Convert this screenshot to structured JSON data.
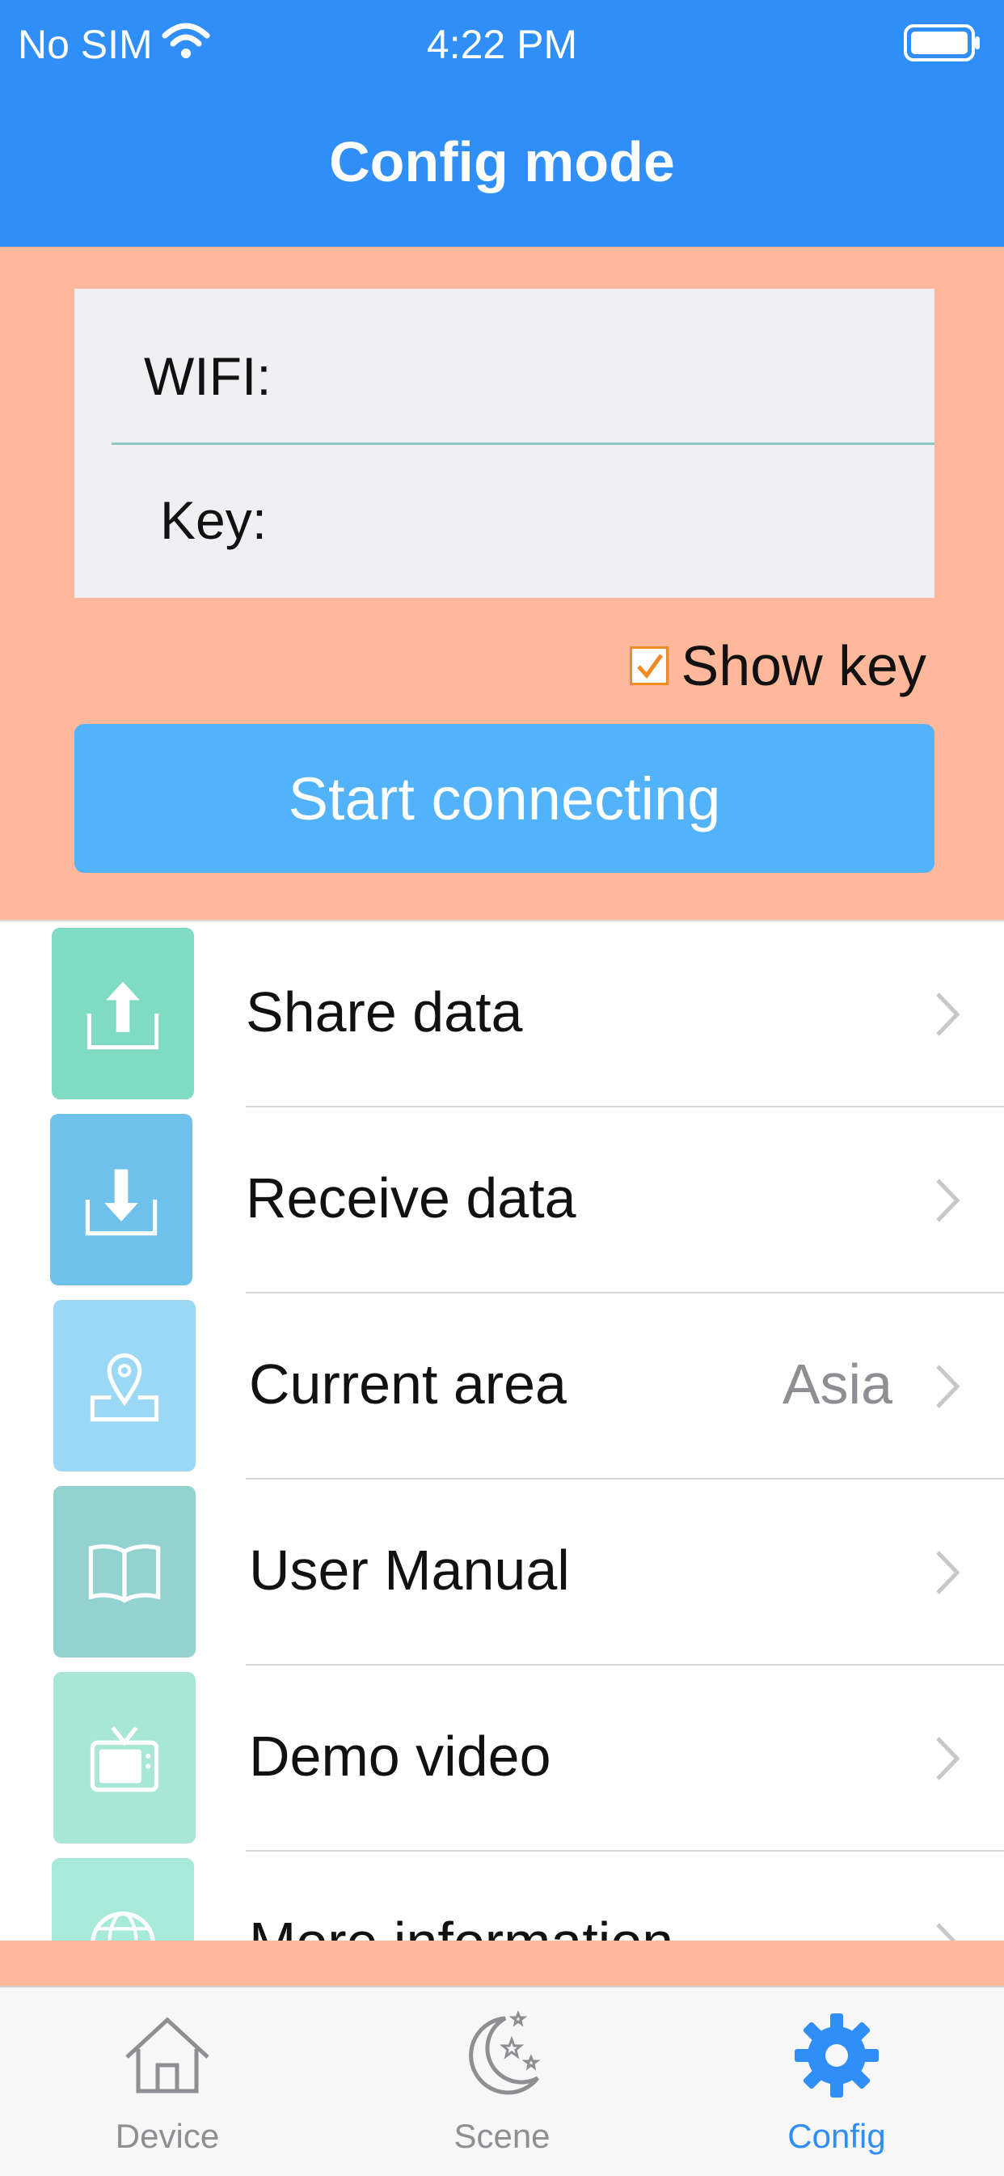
{
  "status_bar": {
    "carrier": "No SIM",
    "time": "4:22 PM"
  },
  "header": {
    "title": "Config mode"
  },
  "form": {
    "wifi_label": "WIFI:",
    "wifi_value": "",
    "key_label": "Key:",
    "key_value": "",
    "show_key_label": "Show key",
    "show_key_checked": true,
    "start_button": "Start connecting"
  },
  "menu": {
    "items": [
      {
        "label": "Share data",
        "value": "",
        "icon": "share-upload-icon",
        "color": "#7FDBC1"
      },
      {
        "label": "Receive data",
        "value": "",
        "icon": "receive-download-icon",
        "color": "#6EC1EB"
      },
      {
        "label": "Current area",
        "value": "Asia",
        "icon": "location-pin-icon",
        "color": "#9AD8F5"
      },
      {
        "label": "User Manual",
        "value": "",
        "icon": "book-icon",
        "color": "#93D3CF"
      },
      {
        "label": "Demo video",
        "value": "",
        "icon": "tv-icon",
        "color": "#A8E6D5"
      },
      {
        "label": "More information",
        "value": "",
        "icon": "globe-icon",
        "color": "#A8EAD9"
      }
    ]
  },
  "tabbar": {
    "tabs": [
      {
        "label": "Device",
        "icon": "house-icon",
        "active": false
      },
      {
        "label": "Scene",
        "icon": "moon-stars-icon",
        "active": false
      },
      {
        "label": "Config",
        "icon": "gear-icon",
        "active": true
      }
    ]
  },
  "colors": {
    "header": "#2F8EF7",
    "config_bg": "#FFB899",
    "button": "#52B3FB",
    "active_tab": "#2F8EF7"
  }
}
